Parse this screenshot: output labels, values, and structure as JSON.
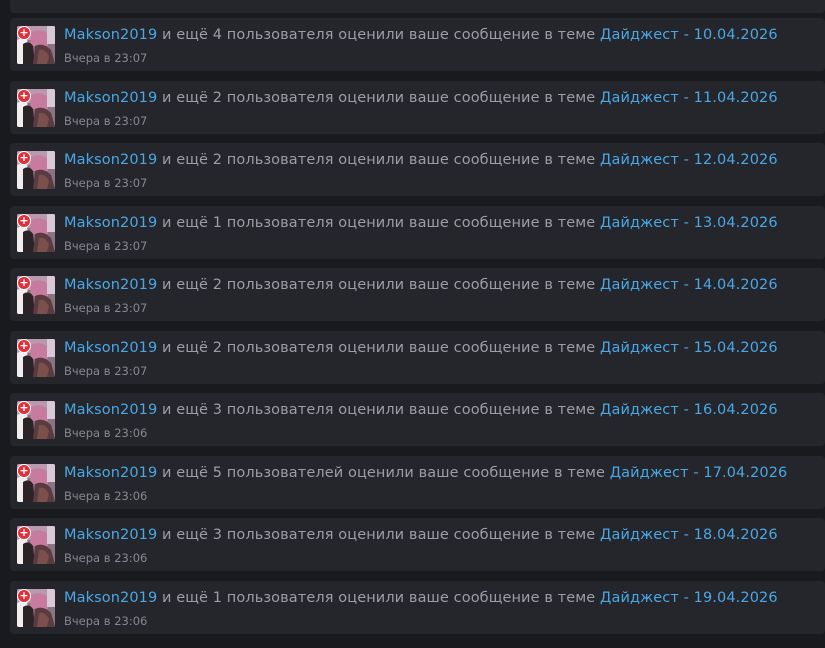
{
  "notifications": [
    {
      "user": "Makson2019",
      "count_text": "и ещё 4 пользователя оценили ваше сообщение в теме",
      "thread": "Дайджест - 10.04.2026",
      "time": "Вчера в 23:07",
      "avatar_icon": "user-avatar",
      "badge_icon": "plus-reaction-icon"
    },
    {
      "user": "Makson2019",
      "count_text": "и ещё 2 пользователя оценили ваше сообщение в теме",
      "thread": "Дайджест - 11.04.2026",
      "time": "Вчера в 23:07",
      "avatar_icon": "user-avatar",
      "badge_icon": "plus-reaction-icon"
    },
    {
      "user": "Makson2019",
      "count_text": "и ещё 2 пользователя оценили ваше сообщение в теме",
      "thread": "Дайджест - 12.04.2026",
      "time": "Вчера в 23:07",
      "avatar_icon": "user-avatar",
      "badge_icon": "plus-reaction-icon"
    },
    {
      "user": "Makson2019",
      "count_text": "и ещё 1 пользователя оценили ваше сообщение в теме",
      "thread": "Дайджест - 13.04.2026",
      "time": "Вчера в 23:07",
      "avatar_icon": "user-avatar",
      "badge_icon": "plus-reaction-icon"
    },
    {
      "user": "Makson2019",
      "count_text": "и ещё 2 пользователя оценили ваше сообщение в теме",
      "thread": "Дайджест - 14.04.2026",
      "time": "Вчера в 23:07",
      "avatar_icon": "user-avatar",
      "badge_icon": "plus-reaction-icon"
    },
    {
      "user": "Makson2019",
      "count_text": "и ещё 2 пользователя оценили ваше сообщение в теме",
      "thread": "Дайджест - 15.04.2026",
      "time": "Вчера в 23:07",
      "avatar_icon": "user-avatar",
      "badge_icon": "plus-reaction-icon"
    },
    {
      "user": "Makson2019",
      "count_text": "и ещё 3 пользователя оценили ваше сообщение в теме",
      "thread": "Дайджест - 16.04.2026",
      "time": "Вчера в 23:06",
      "avatar_icon": "user-avatar",
      "badge_icon": "plus-reaction-icon"
    },
    {
      "user": "Makson2019",
      "count_text": "и ещё 5 пользователей оценили ваше сообщение в теме",
      "thread": "Дайджест - 17.04.2026",
      "time": "Вчера в 23:06",
      "avatar_icon": "user-avatar",
      "badge_icon": "plus-reaction-icon"
    },
    {
      "user": "Makson2019",
      "count_text": "и ещё 3 пользователя оценили ваше сообщение в теме",
      "thread": "Дайджест - 18.04.2026",
      "time": "Вчера в 23:06",
      "avatar_icon": "user-avatar",
      "badge_icon": "plus-reaction-icon"
    },
    {
      "user": "Makson2019",
      "count_text": "и ещё 1 пользователя оценили ваше сообщение в теме",
      "thread": "Дайджест - 19.04.2026",
      "time": "Вчера в 23:06",
      "avatar_icon": "user-avatar",
      "badge_icon": "plus-reaction-icon"
    }
  ],
  "badge_symbol": "+",
  "colors": {
    "background": "#191a1e",
    "card": "#24262b",
    "link": "#4aa7e6",
    "text": "#9b9ea6",
    "muted": "#85888f",
    "badge": "#e0303a"
  }
}
